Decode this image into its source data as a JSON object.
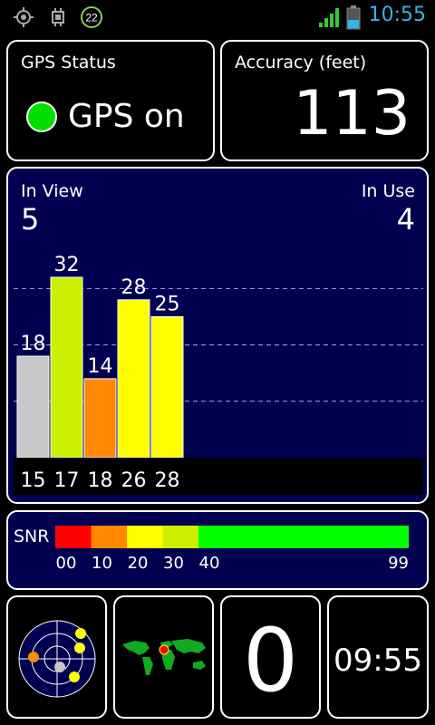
{
  "statusbar": {
    "time": "10:55",
    "icons": [
      "gps-target-icon",
      "cpu-chip-icon",
      "notification-badge-icon",
      "signal-strength-icon",
      "battery-icon"
    ],
    "badge_number": "22",
    "signal_color": "#33cc33",
    "time_color": "#33b5e5"
  },
  "gps_status": {
    "title": "GPS Status",
    "state_text": "GPS on",
    "indicator_color": "#00e000"
  },
  "accuracy": {
    "title": "Accuracy (feet)",
    "value": "113"
  },
  "satellites": {
    "in_view_label": "In View",
    "in_view_value": "5",
    "in_use_label": "In Use",
    "in_use_value": "4",
    "background_color": "#000050"
  },
  "chart_data": {
    "type": "bar",
    "categories": [
      "15",
      "17",
      "18",
      "26",
      "28"
    ],
    "values": [
      18,
      32,
      14,
      28,
      25
    ],
    "colors": [
      "#c8c8c8",
      "#ccf000",
      "#ff8800",
      "#ffff00",
      "#ffff00"
    ],
    "ylim": [
      0,
      50
    ],
    "grid": true,
    "gridlines": [
      10,
      20,
      30
    ]
  },
  "snr_scale": {
    "label": "SNR",
    "ticks": [
      {
        "label": "00",
        "value": 0
      },
      {
        "label": "10",
        "value": 10
      },
      {
        "label": "20",
        "value": 20
      },
      {
        "label": "30",
        "value": 30
      },
      {
        "label": "40",
        "value": 40
      },
      {
        "label": "99",
        "value": 99
      }
    ],
    "segments": [
      {
        "from": 0,
        "to": 10,
        "color": "#ff0000"
      },
      {
        "from": 10,
        "to": 20,
        "color": "#ff8800"
      },
      {
        "from": 20,
        "to": 30,
        "color": "#ffff00"
      },
      {
        "from": 30,
        "to": 40,
        "color": "#ccf000"
      },
      {
        "from": 40,
        "to": 99,
        "color": "#00ff00"
      }
    ]
  },
  "sky_view": {
    "icon": "sky-radar-icon"
  },
  "world_map": {
    "icon": "world-map-icon"
  },
  "fix_count": {
    "value": "0"
  },
  "clock": {
    "value": "09:55"
  }
}
